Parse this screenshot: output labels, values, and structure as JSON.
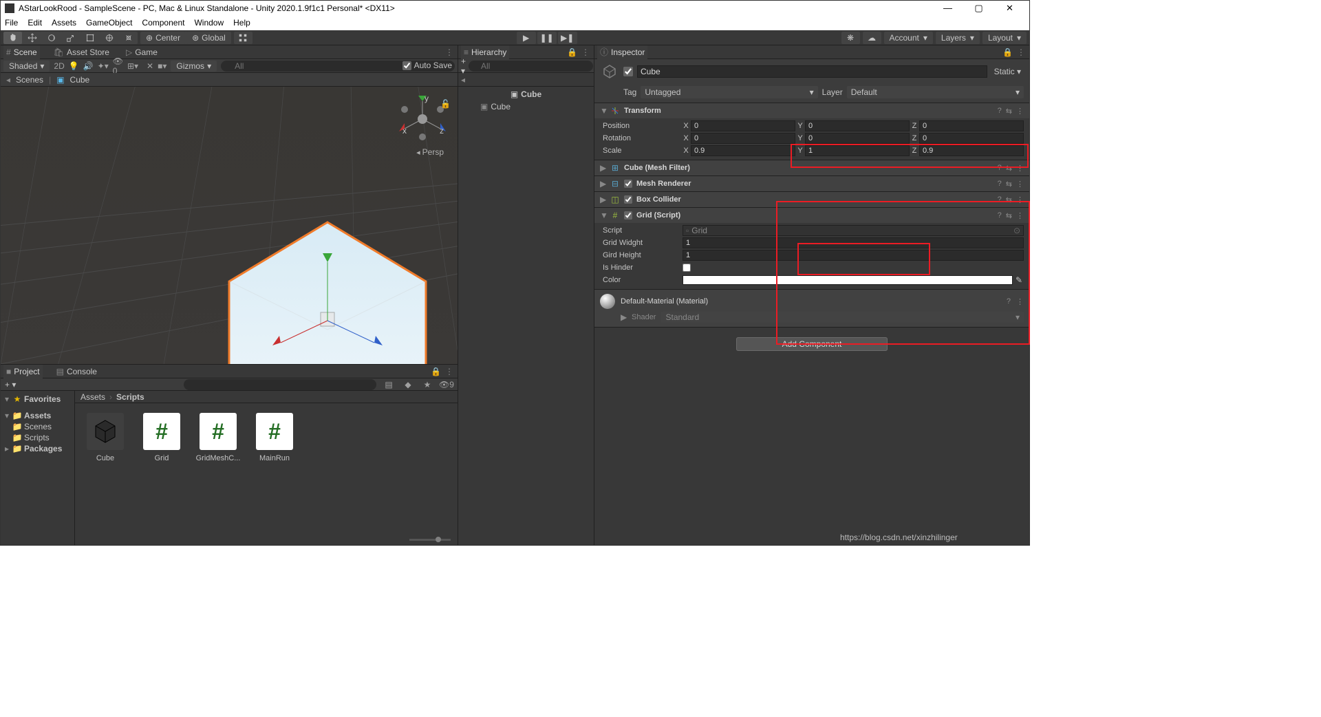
{
  "titlebar": {
    "title": "AStarLookRood - SampleScene - PC, Mac & Linux Standalone - Unity 2020.1.9f1c1 Personal* <DX11>"
  },
  "menubar": [
    "File",
    "Edit",
    "Assets",
    "GameObject",
    "Component",
    "Window",
    "Help"
  ],
  "toolbar": {
    "center": "Center",
    "global": "Global",
    "account": "Account",
    "layers": "Layers",
    "layout": "Layout"
  },
  "scene": {
    "tabs": {
      "scene": "Scene",
      "asset_store": "Asset Store",
      "game": "Game"
    },
    "shaded": "Shaded",
    "d2": "2D",
    "gizmos": "Gizmos",
    "all_ph": "All",
    "breadcrumb": {
      "scenes": "Scenes",
      "cube": "Cube"
    },
    "autosave": "Auto Save",
    "persp": "Persp",
    "axes": {
      "x": "x",
      "y": "y",
      "z": "z"
    }
  },
  "hierarchy": {
    "title": "Hierarchy",
    "all_ph": "All",
    "scene_name": "Cube",
    "item": "Cube"
  },
  "inspector": {
    "title": "Inspector",
    "go_name": "Cube",
    "static": "Static",
    "tag_label": "Tag",
    "tag_value": "Untagged",
    "layer_label": "Layer",
    "layer_value": "Default",
    "transform": {
      "title": "Transform",
      "position": {
        "label": "Position",
        "x": "0",
        "y": "0",
        "z": "0"
      },
      "rotation": {
        "label": "Rotation",
        "x": "0",
        "y": "0",
        "z": "0"
      },
      "scale": {
        "label": "Scale",
        "x": "0.9",
        "y": "1",
        "z": "0.9"
      }
    },
    "mesh_filter": "Cube (Mesh Filter)",
    "mesh_renderer": "Mesh Renderer",
    "box_collider": "Box Collider",
    "grid_script": {
      "title": "Grid (Script)",
      "script_label": "Script",
      "script_value": "Grid",
      "width_label": "Grid Widght",
      "width": "1",
      "height_label": "Gird Height",
      "height": "1",
      "hinder_label": "Is Hinder",
      "color_label": "Color"
    },
    "material": {
      "title": "Default-Material (Material)",
      "shader_label": "Shader",
      "shader_value": "Standard"
    },
    "add_component": "Add Component"
  },
  "project": {
    "tabs": {
      "project": "Project",
      "console": "Console"
    },
    "hidden": "9",
    "tree": {
      "favorites": "Favorites",
      "assets": "Assets",
      "scenes": "Scenes",
      "scripts": "Scripts",
      "packages": "Packages"
    },
    "breadcrumb": {
      "assets": "Assets",
      "scripts": "Scripts"
    },
    "items": [
      "Cube",
      "Grid",
      "GridMeshC...",
      "MainRun"
    ]
  },
  "watermark": "https://blog.csdn.net/xinzhilinger"
}
